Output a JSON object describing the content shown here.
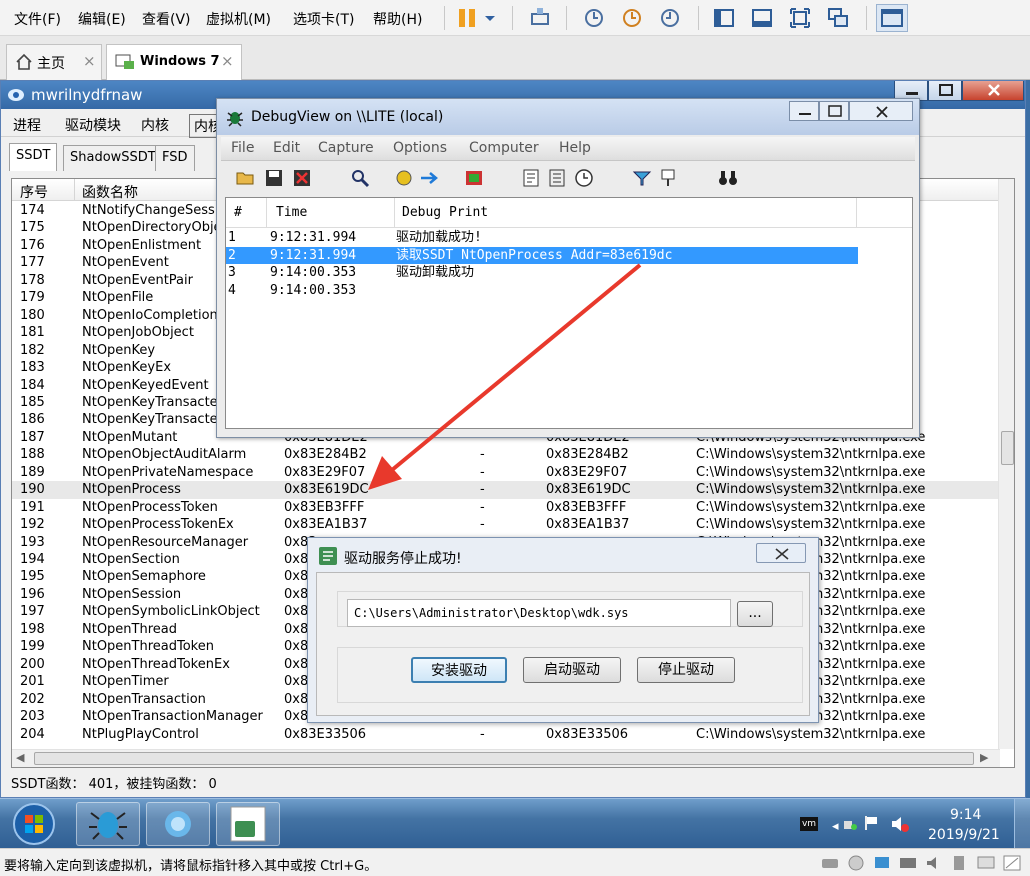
{
  "vmware": {
    "menu": [
      "文件(F)",
      "编辑(E)",
      "查看(V)",
      "虚拟机(M)",
      "选项卡(T)",
      "帮助(H)"
    ],
    "tabs": [
      {
        "label": "主页",
        "close": "×"
      },
      {
        "label": "Windows 7",
        "close": "×"
      }
    ],
    "status_text": "要将输入定向到该虚拟机，请将鼠标指针移入其中或按 Ctrl+G。"
  },
  "app": {
    "title": "mwrilnydfrnaw",
    "menu": [
      "进程",
      "驱动模块",
      "内核",
      "内核"
    ],
    "tabs": [
      "SSDT",
      "ShadowSSDT",
      "FSD"
    ],
    "columns": {
      "index": "序号",
      "name": "函数名称"
    },
    "rows": [
      {
        "i": "174",
        "name": "NtNotifyChangeSession",
        "cur": "",
        "hook": "",
        "orig": "",
        "module": ""
      },
      {
        "i": "175",
        "name": "NtOpenDirectoryObject",
        "cur": "",
        "hook": "",
        "orig": "",
        "module": ""
      },
      {
        "i": "176",
        "name": "NtOpenEnlistment",
        "cur": "",
        "hook": "",
        "orig": "",
        "module": ""
      },
      {
        "i": "177",
        "name": "NtOpenEvent",
        "cur": "",
        "hook": "",
        "orig": "",
        "module": ""
      },
      {
        "i": "178",
        "name": "NtOpenEventPair",
        "cur": "",
        "hook": "",
        "orig": "",
        "module": ""
      },
      {
        "i": "179",
        "name": "NtOpenFile",
        "cur": "",
        "hook": "",
        "orig": "",
        "module": ""
      },
      {
        "i": "180",
        "name": "NtOpenIoCompletion",
        "cur": "",
        "hook": "",
        "orig": "",
        "module": ""
      },
      {
        "i": "181",
        "name": "NtOpenJobObject",
        "cur": "",
        "hook": "",
        "orig": "",
        "module": ""
      },
      {
        "i": "182",
        "name": "NtOpenKey",
        "cur": "",
        "hook": "",
        "orig": "",
        "module": ""
      },
      {
        "i": "183",
        "name": "NtOpenKeyEx",
        "cur": "",
        "hook": "",
        "orig": "",
        "module": ""
      },
      {
        "i": "184",
        "name": "NtOpenKeyedEvent",
        "cur": "",
        "hook": "",
        "orig": "",
        "module": ""
      },
      {
        "i": "185",
        "name": "NtOpenKeyTransacted",
        "cur": "",
        "hook": "",
        "orig": "",
        "module": ""
      },
      {
        "i": "186",
        "name": "NtOpenKeyTransacted",
        "cur": "",
        "hook": "",
        "orig": "",
        "module": ""
      },
      {
        "i": "187",
        "name": "NtOpenMutant",
        "cur": "0x83E81DE2",
        "hook": "",
        "orig": "0x83E81DE2",
        "module": "C:\\Windows\\system32\\ntkrnlpa.exe"
      },
      {
        "i": "188",
        "name": "NtOpenObjectAuditAlarm",
        "cur": "0x83E284B2",
        "hook": "-",
        "orig": "0x83E284B2",
        "module": "C:\\Windows\\system32\\ntkrnlpa.exe"
      },
      {
        "i": "189",
        "name": "NtOpenPrivateNamespace",
        "cur": "0x83E29F07",
        "hook": "-",
        "orig": "0x83E29F07",
        "module": "C:\\Windows\\system32\\ntkrnlpa.exe"
      },
      {
        "i": "190",
        "name": "NtOpenProcess",
        "cur": "0x83E619DC",
        "hook": "-",
        "orig": "0x83E619DC",
        "module": "C:\\Windows\\system32\\ntkrnlpa.exe"
      },
      {
        "i": "191",
        "name": "NtOpenProcessToken",
        "cur": "0x83EB3FFF",
        "hook": "-",
        "orig": "0x83EB3FFF",
        "module": "C:\\Windows\\system32\\ntkrnlpa.exe"
      },
      {
        "i": "192",
        "name": "NtOpenProcessTokenEx",
        "cur": "0x83EA1B37",
        "hook": "-",
        "orig": "0x83EA1B37",
        "module": "C:\\Windows\\system32\\ntkrnlpa.exe"
      },
      {
        "i": "193",
        "name": "NtOpenResourceManager",
        "cur": "0x83",
        "hook": "",
        "orig": "",
        "module": "C:\\Windows\\system32\\ntkrnlpa.exe"
      },
      {
        "i": "194",
        "name": "NtOpenSection",
        "cur": "0x83",
        "hook": "",
        "orig": "",
        "module": "C:\\Windows\\system32\\ntkrnlpa.exe"
      },
      {
        "i": "195",
        "name": "NtOpenSemaphore",
        "cur": "0x83",
        "hook": "",
        "orig": "",
        "module": "C:\\Windows\\system32\\ntkrnlpa.exe"
      },
      {
        "i": "196",
        "name": "NtOpenSession",
        "cur": "0x83",
        "hook": "",
        "orig": "",
        "module": "C:\\Windows\\system32\\ntkrnlpa.exe"
      },
      {
        "i": "197",
        "name": "NtOpenSymbolicLinkObject",
        "cur": "0x83",
        "hook": "",
        "orig": "",
        "module": "C:\\Windows\\system32\\ntkrnlpa.exe"
      },
      {
        "i": "198",
        "name": "NtOpenThread",
        "cur": "0x83",
        "hook": "",
        "orig": "",
        "module": "C:\\Windows\\system32\\ntkrnlpa.exe"
      },
      {
        "i": "199",
        "name": "NtOpenThreadToken",
        "cur": "0x83",
        "hook": "",
        "orig": "",
        "module": "C:\\Windows\\system32\\ntkrnlpa.exe"
      },
      {
        "i": "200",
        "name": "NtOpenThreadTokenEx",
        "cur": "0x83",
        "hook": "",
        "orig": "",
        "module": "C:\\Windows\\system32\\ntkrnlpa.exe"
      },
      {
        "i": "201",
        "name": "NtOpenTimer",
        "cur": "0x83",
        "hook": "",
        "orig": "",
        "module": "C:\\Windows\\system32\\ntkrnlpa.exe"
      },
      {
        "i": "202",
        "name": "NtOpenTransaction",
        "cur": "0x83",
        "hook": "",
        "orig": "",
        "module": "C:\\Windows\\system32\\ntkrnlpa.exe"
      },
      {
        "i": "203",
        "name": "NtOpenTransactionManager",
        "cur": "0x83",
        "hook": "",
        "orig": "",
        "module": "C:\\Windows\\system32\\ntkrnlpa.exe"
      },
      {
        "i": "204",
        "name": "NtPlugPlayControl",
        "cur": "0x83E33506",
        "hook": "-",
        "orig": "0x83E33506",
        "module": "C:\\Windows\\system32\\ntkrnlpa.exe"
      }
    ],
    "status": "SSDT函数：  401，被挂钩函数：  0"
  },
  "debugview": {
    "title": "DebugView on \\\\LITE (local)",
    "menu": [
      "File",
      "Edit",
      "Capture",
      "Options",
      "Computer",
      "Help"
    ],
    "columns": {
      "num": "#",
      "time": "Time",
      "print": "Debug Print"
    },
    "rows": [
      {
        "n": "1",
        "time": "9:12:31.994",
        "msg": "驱动加载成功!"
      },
      {
        "n": "2",
        "time": "9:12:31.994",
        "msg": "读取SSDT NtOpenProcess Addr=83e619dc"
      },
      {
        "n": "3",
        "time": "9:14:00.353",
        "msg": "驱动卸载成功"
      },
      {
        "n": "4",
        "time": "9:14:00.353",
        "msg": ""
      }
    ]
  },
  "driver_dialog": {
    "title": "驱动服务停止成功!",
    "path_value": "C:\\Users\\Administrator\\Desktop\\wdk.sys",
    "browse_label": "...",
    "install_label": "安装驱动",
    "start_label": "启动驱动",
    "stop_label": "停止驱动"
  },
  "taskbar": {
    "time": "9:14",
    "date": "2019/9/21"
  },
  "colors": {
    "accent": "#3399ff",
    "arrow": "#e8392c",
    "titlebar": "#3569a6"
  }
}
